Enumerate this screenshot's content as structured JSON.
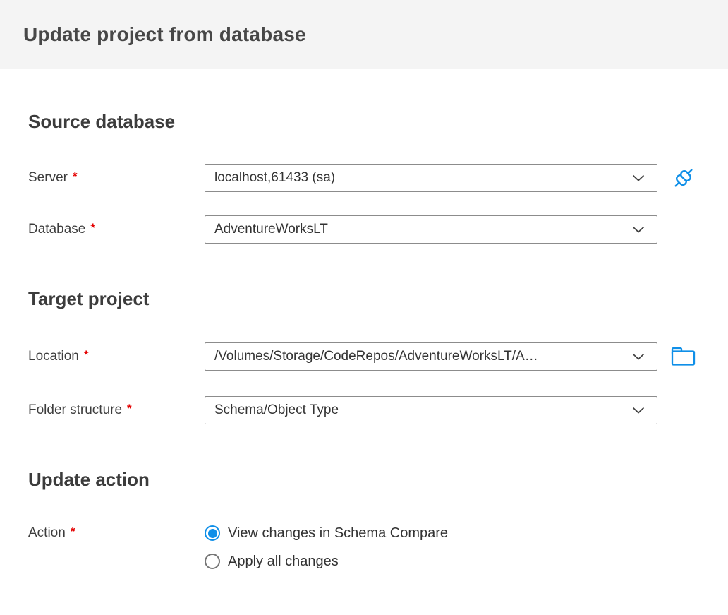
{
  "header": {
    "title": "Update project from database"
  },
  "sections": {
    "source": {
      "title": "Source database",
      "fields": {
        "server": {
          "label": "Server",
          "required": "*",
          "value": "localhost,61433 (sa)"
        },
        "database": {
          "label": "Database",
          "required": "*",
          "value": "AdventureWorksLT"
        }
      }
    },
    "target": {
      "title": "Target project",
      "fields": {
        "location": {
          "label": "Location",
          "required": "*",
          "value": "/Volumes/Storage/CodeRepos/AdventureWorksLT/A…"
        },
        "folder_structure": {
          "label": "Folder structure",
          "required": "*",
          "value": "Schema/Object Type"
        }
      }
    },
    "update": {
      "title": "Update action",
      "action_label": "Action",
      "required": "*",
      "options": [
        {
          "label": "View changes in Schema Compare",
          "selected": true
        },
        {
          "label": "Apply all changes",
          "selected": false
        }
      ]
    }
  },
  "icons": {
    "server_connect_button": "plug-icon",
    "location_browse_button": "folder-icon",
    "dropdown_indicator": "chevron-down-icon",
    "action_selected": "radio-selected-icon",
    "action_unselected": "radio-unselected-icon"
  },
  "colors": {
    "accent_blue": "#0f8fe8",
    "required_asterisk_red": "#e40000",
    "header_background": "#f4f4f4",
    "field_border_gray": "#8c8c8c",
    "text_dark": "#3d3d3d"
  }
}
